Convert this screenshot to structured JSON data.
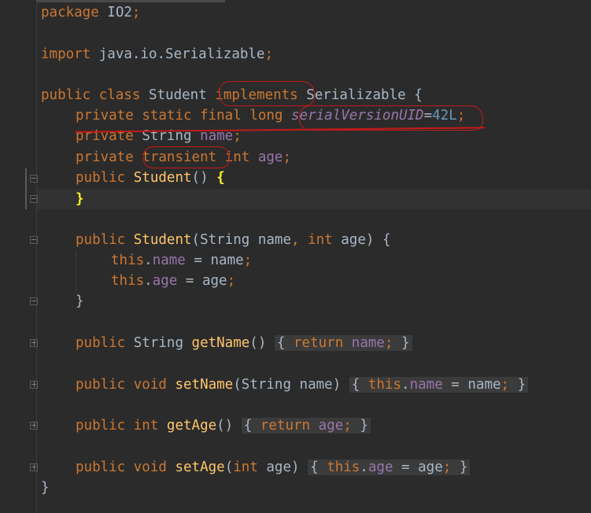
{
  "editor": {
    "lines": {
      "package_kw": "package",
      "package_name": " IO2",
      "semi": ";",
      "import_kw": "import",
      "import_name": " java.io.Serializable",
      "public_kw": "public",
      "class_kw": "class",
      "class_name": "Student",
      "implements_kw": "implements",
      "iface_name": "Serializable",
      "open_brace": "{",
      "close_brace": "}",
      "private_kw": "private",
      "static_kw": "static",
      "final_kw": "final",
      "long_kw": "long",
      "serial_name": "serialVersionUID",
      "equals": "=",
      "serial_value": "42L",
      "string_type": "String",
      "name_field": "name",
      "transient_kw": "transient",
      "int_kw": "int",
      "age_field": "age",
      "ctor_name": "Student",
      "empty_parens": "()",
      "param_list_open": "(",
      "param_list_close": ")",
      "this_kw": "this",
      "dot": ".",
      "comma": ",",
      "getname": "getName",
      "setname": "setName",
      "getage": "getAge",
      "setage": "setAge",
      "return_kw": "return",
      "void_kw": "void"
    }
  }
}
